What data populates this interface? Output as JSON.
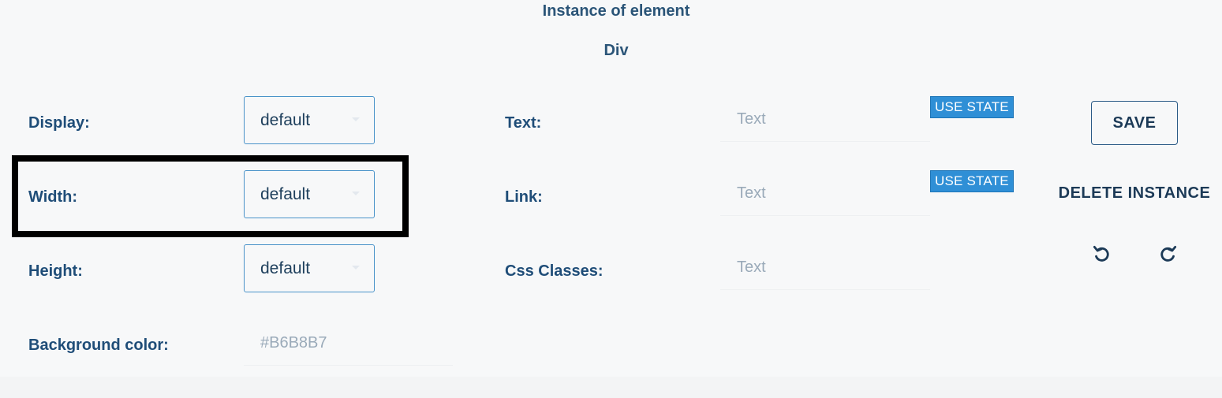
{
  "header": {
    "title": "Instance of element",
    "element_type": "Div"
  },
  "left_fields": {
    "display": {
      "label": "Display:",
      "value": "default"
    },
    "width": {
      "label": "Width:",
      "value": "default"
    },
    "height": {
      "label": "Height:",
      "value": "default"
    },
    "background_color": {
      "label": "Background color:",
      "placeholder": "#B6B8B7"
    }
  },
  "right_fields": {
    "text": {
      "label": "Text:",
      "placeholder": "Text",
      "state_button": "USE STATE"
    },
    "link": {
      "label": "Link:",
      "placeholder": "Text",
      "state_button": "USE STATE"
    },
    "css_classes": {
      "label": "Css Classes:",
      "placeholder": "Text"
    }
  },
  "actions": {
    "save_label": "SAVE",
    "delete_label": "DELETE INSTANCE",
    "undo_icon": "undo-icon",
    "redo_icon": "redo-icon"
  },
  "colors": {
    "accent": "#2f8fd6",
    "label_text": "#1f4d78",
    "highlight_border": "#000000"
  }
}
